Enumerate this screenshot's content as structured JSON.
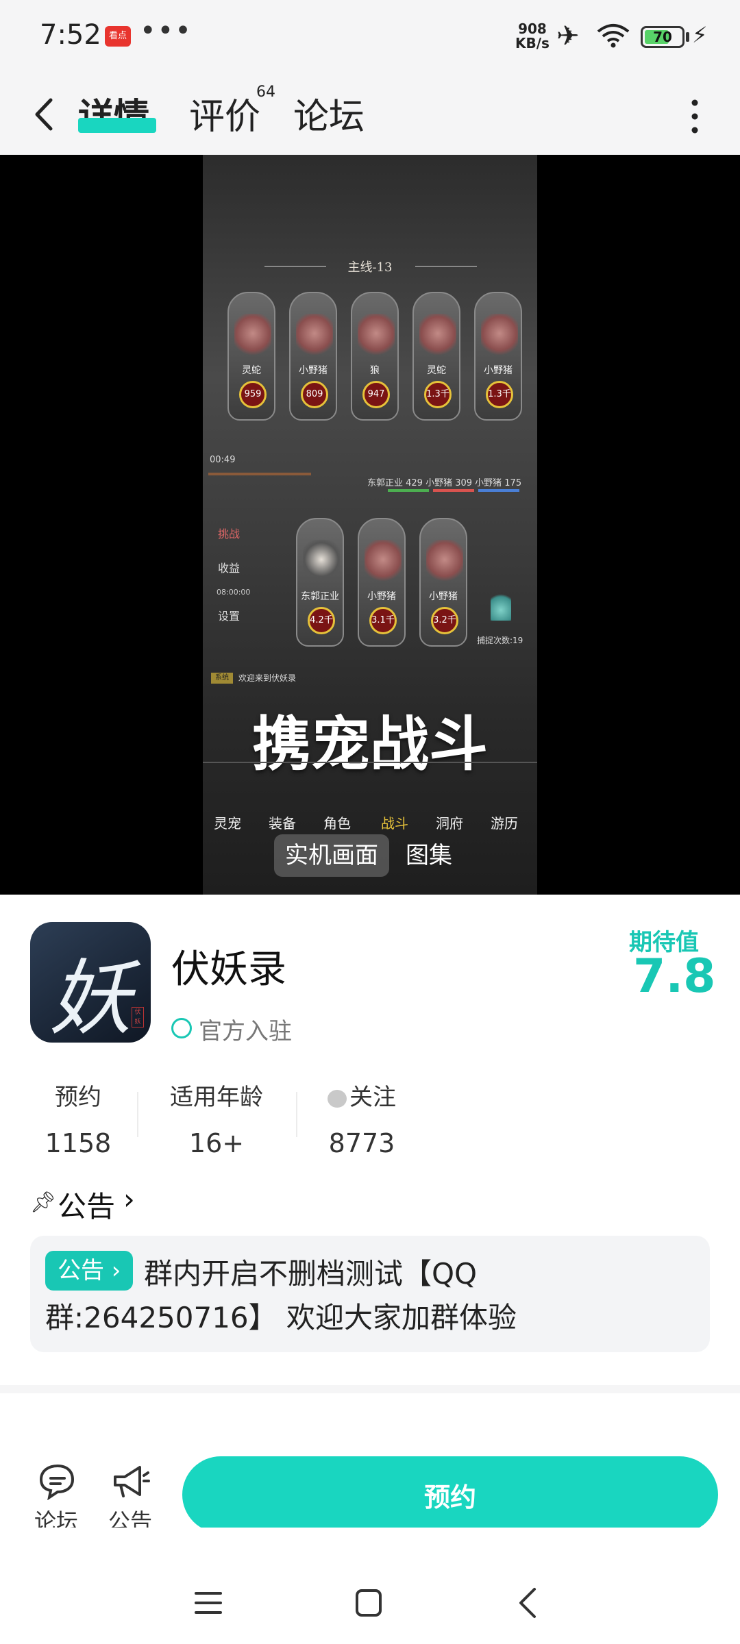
{
  "status_bar": {
    "time": "7:52",
    "app_badge": "看点",
    "more_dots": "•••",
    "net_speed_value": "908",
    "net_speed_unit": "KB/s",
    "battery_level": 70,
    "battery_text": "70"
  },
  "nav": {
    "tabs": [
      {
        "label": "详情",
        "active": true
      },
      {
        "label": "评价",
        "badge": "64"
      },
      {
        "label": "论坛"
      }
    ]
  },
  "media": {
    "stage_title": "主线-13",
    "enemies": [
      {
        "name": "灵蛇",
        "power": "959"
      },
      {
        "name": "小野猪",
        "power": "809"
      },
      {
        "name": "狼",
        "power": "947"
      },
      {
        "name": "灵蛇",
        "power": "1.3千"
      },
      {
        "name": "小野猪",
        "power": "1.3千"
      }
    ],
    "allies": [
      {
        "name": "东郭正业",
        "power": "4.2千"
      },
      {
        "name": "小野猪",
        "power": "3.1千"
      },
      {
        "name": "小野猪",
        "power": "3.2千"
      }
    ],
    "timer": "00:49",
    "team_hp": "东郭正业 429  小野猪 309  小野猪 175",
    "side_buttons": [
      "挑战",
      "收益",
      "设置"
    ],
    "side_time": "08:00:00",
    "catch_count": "捕捉次数:19",
    "system_tag": "系统",
    "system_msg": "欢迎来到伏妖录",
    "promo_text": "携宠战斗",
    "game_nav": [
      "灵宠",
      "装备",
      "角色",
      "战斗",
      "洞府",
      "游历"
    ],
    "chips": [
      {
        "label": "实机画面",
        "selected": true
      },
      {
        "label": "图集",
        "selected": false
      }
    ]
  },
  "app": {
    "name": "伏妖录",
    "icon_glyph": "妖",
    "icon_seal": "伏妖",
    "verified_text": "官方入驻",
    "score_label": "期待值",
    "score_value": "7.8",
    "stats": [
      {
        "label": "预约",
        "value": "1158"
      },
      {
        "label": "适用年龄",
        "value": "16+"
      },
      {
        "label": "关注",
        "value": "8773"
      }
    ]
  },
  "notice": {
    "title": "公告",
    "chevron": "›",
    "tag": "公告 ›",
    "text": "群内开启不删档测试【QQ群:264250716】 欢迎大家加群体验"
  },
  "actions": {
    "forum_label": "论坛",
    "notice_label": "公告",
    "reserve_label": "预约"
  },
  "colors": {
    "accent": "#19d6c0",
    "accent_text": "#19c7b4",
    "battery": "#58d268"
  }
}
